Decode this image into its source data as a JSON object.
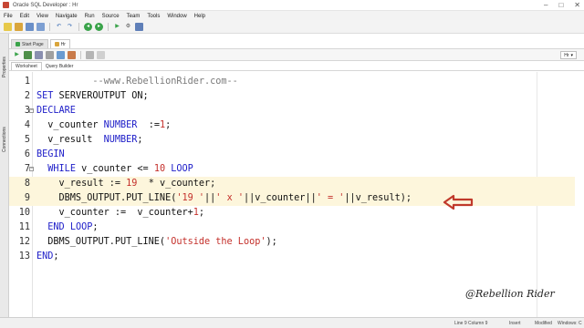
{
  "window": {
    "title": "Oracle SQL Developer : Hr",
    "controls": [
      "–",
      "□",
      "✕"
    ]
  },
  "menu": [
    "File",
    "Edit",
    "View",
    "Navigate",
    "Run",
    "Source",
    "Team",
    "Tools",
    "Window",
    "Help"
  ],
  "side_tabs": {
    "properties": "Properties",
    "connections": "Connections"
  },
  "doc_tabs": [
    {
      "label": "Start Page",
      "active": false
    },
    {
      "label": "Hr",
      "active": true
    }
  ],
  "connection": {
    "label": "Hr"
  },
  "sub_tabs": [
    {
      "label": "Worksheet",
      "active": true
    },
    {
      "label": "Query Builder",
      "active": false
    }
  ],
  "editor": {
    "highlighted_lines": [
      8,
      9
    ],
    "lines": [
      {
        "n": "1",
        "tokens": [
          {
            "t": "          --www.RebellionRider.com--",
            "c": "cm"
          }
        ]
      },
      {
        "n": "2",
        "tokens": [
          {
            "t": "SET ",
            "c": "kw"
          },
          {
            "t": "SERVEROUTPUT ON;",
            "c": "tx"
          }
        ]
      },
      {
        "n": "3",
        "fold": "−",
        "tokens": [
          {
            "t": "DECLARE",
            "c": "kw"
          }
        ]
      },
      {
        "n": "4",
        "tokens": [
          {
            "t": "  v_counter ",
            "c": "tx"
          },
          {
            "t": "NUMBER",
            "c": "kw"
          },
          {
            "t": "  :=",
            "c": "tx"
          },
          {
            "t": "1",
            "c": "num"
          },
          {
            "t": ";",
            "c": "tx"
          }
        ]
      },
      {
        "n": "5",
        "tokens": [
          {
            "t": "  v_result  ",
            "c": "tx"
          },
          {
            "t": "NUMBER",
            "c": "kw"
          },
          {
            "t": ";",
            "c": "tx"
          }
        ]
      },
      {
        "n": "6",
        "tokens": [
          {
            "t": "BEGIN",
            "c": "kw"
          }
        ]
      },
      {
        "n": "7",
        "fold": "−",
        "tokens": [
          {
            "t": "  ",
            "c": "tx"
          },
          {
            "t": "WHILE",
            "c": "kw"
          },
          {
            "t": " v_counter <= ",
            "c": "tx"
          },
          {
            "t": "10",
            "c": "num"
          },
          {
            "t": " LOOP",
            "c": "kw"
          }
        ]
      },
      {
        "n": "8",
        "tokens": [
          {
            "t": "    v_result := ",
            "c": "tx"
          },
          {
            "t": "19",
            "c": "num"
          },
          {
            "t": "  * v_counter;",
            "c": "tx"
          }
        ]
      },
      {
        "n": "9",
        "tokens": [
          {
            "t": "    DBMS_OUTPUT.PUT_LINE(",
            "c": "tx"
          },
          {
            "t": "'19 '",
            "c": "str"
          },
          {
            "t": "||",
            "c": "tx"
          },
          {
            "t": "' x '",
            "c": "str"
          },
          {
            "t": "||v_counter||",
            "c": "tx"
          },
          {
            "t": "' = '",
            "c": "str"
          },
          {
            "t": "||v_result);",
            "c": "tx"
          }
        ]
      },
      {
        "n": "10",
        "tokens": [
          {
            "t": "    v_counter :=  v_counter+",
            "c": "tx"
          },
          {
            "t": "1",
            "c": "num"
          },
          {
            "t": ";",
            "c": "tx"
          }
        ]
      },
      {
        "n": "11",
        "tokens": [
          {
            "t": "  ",
            "c": "tx"
          },
          {
            "t": "END LOOP",
            "c": "kw"
          },
          {
            "t": ";",
            "c": "tx"
          }
        ]
      },
      {
        "n": "12",
        "tokens": [
          {
            "t": "  DBMS_OUTPUT.PUT_LINE(",
            "c": "tx"
          },
          {
            "t": "'Outside the Loop'",
            "c": "str"
          },
          {
            "t": ");",
            "c": "tx"
          }
        ]
      },
      {
        "n": "13",
        "tokens": [
          {
            "t": "END",
            "c": "kw"
          },
          {
            "t": ";",
            "c": "tx"
          }
        ]
      }
    ]
  },
  "watermark": "@Rebellion Rider",
  "annotation": {
    "arrow_color": "#c0392b",
    "points_to_line": 9
  },
  "status": {
    "position": "Line 9 Column 9",
    "mode": "Insert",
    "modified": "Modified",
    "os": "Windows: C"
  },
  "colors": {
    "keyword": "#1c1cc8",
    "literal": "#c4302b",
    "comment": "#7a7a7a",
    "current_line": "#fdf6dc"
  }
}
